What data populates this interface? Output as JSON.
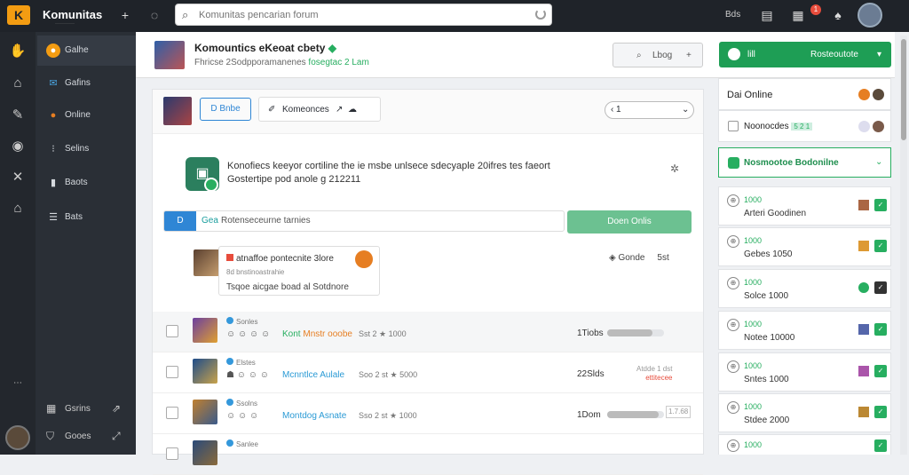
{
  "topbar": {
    "brand": "Komunitas",
    "brand_sub": "···········",
    "search_placeholder": "Komunitas pencarian forum",
    "right_text": "Bds",
    "notif_count": "1"
  },
  "sidebar": {
    "items": [
      {
        "label": "Galhe",
        "icon": "home-circle-icon"
      },
      {
        "label": "Gafins",
        "icon": "chat-icon"
      },
      {
        "label": "Online",
        "icon": "dot-icon"
      },
      {
        "label": "Selins",
        "icon": "list-icon"
      },
      {
        "label": "Baots",
        "icon": "bookmark-icon"
      },
      {
        "label": "Bats",
        "icon": "bars-icon"
      }
    ],
    "footer": [
      {
        "label": "Gsrins",
        "icon": "grid-icon"
      },
      {
        "label": "Gooes",
        "icon": "shield-icon"
      }
    ]
  },
  "header": {
    "title": "Komountics eKeoat cbety",
    "subtitle": "Fhricse 2Sodpporamanenes",
    "subtitle_green": "fosegtac 2 Lam",
    "btn_label": "Lbog",
    "cta_left": "lill",
    "cta_right": "Rosteoutote"
  },
  "toolbar": {
    "btn1": "D Bnbe",
    "btn2": "Komeonces",
    "select_value": "1"
  },
  "card": {
    "line1": "Konofiecs keeyor cortiline the ie msbe unlsece sdecyaple 20ifres tes faeort",
    "line2": "Gostertipe pod anole g 212211",
    "compose_tag": "D",
    "compose_green": "Gea",
    "compose_text": "Rotenseceurne tarnies",
    "button": "Doen Onlis",
    "post_title": "atnaffoe pontecnite 3lore",
    "post_sub": "8d bnstinoastrahie",
    "post_body": "Tsqoe aicgae boad al Sotdnore",
    "right_label": "Gonde",
    "right_count": "5st"
  },
  "rows": [
    {
      "meta": "Sonles",
      "title": "Kont",
      "title2": "Mnstr ooobe",
      "stats": "Sst 2 ★ 1000",
      "count": "1Tiobs",
      "fill": 0.8,
      "end1": "",
      "end2": ""
    },
    {
      "meta": "Elstes",
      "title": "Mcnntlce Aulale",
      "title2": "",
      "stats": "Soo 2 st ★ 5000",
      "count": "22Slds",
      "fill": 0.0,
      "end1": "Atdde 1 dst",
      "end2": "ettitecee"
    },
    {
      "meta": "Ssolns",
      "title": "Montdog Asnate",
      "title2": "",
      "stats": "Sso 2 st ★ 1000",
      "count": "1Dom",
      "fill": 0.9,
      "end1": "1.7.68",
      "end2": ""
    },
    {
      "meta": "Sanlee",
      "title": "",
      "title2": "",
      "stats": "",
      "count": "",
      "fill": 0.0,
      "end1": "",
      "end2": ""
    }
  ],
  "right_panel": {
    "online_label": "Dai Online",
    "item2_label": "Noonocdes",
    "item2_tag": "5 2 1",
    "green_label": "Nosmootoe Bodonilne",
    "items": [
      {
        "num": "1000",
        "name": "Arteri Goodinen"
      },
      {
        "num": "1000",
        "name": "Gebes 1050"
      },
      {
        "num": "1000",
        "name": "Solce 1000"
      },
      {
        "num": "1000",
        "name": "Notee 10000"
      },
      {
        "num": "1000",
        "name": "Sntes 1000"
      },
      {
        "num": "1000",
        "name": "Stdee 2000"
      },
      {
        "num": "1000",
        "name": ""
      }
    ]
  }
}
